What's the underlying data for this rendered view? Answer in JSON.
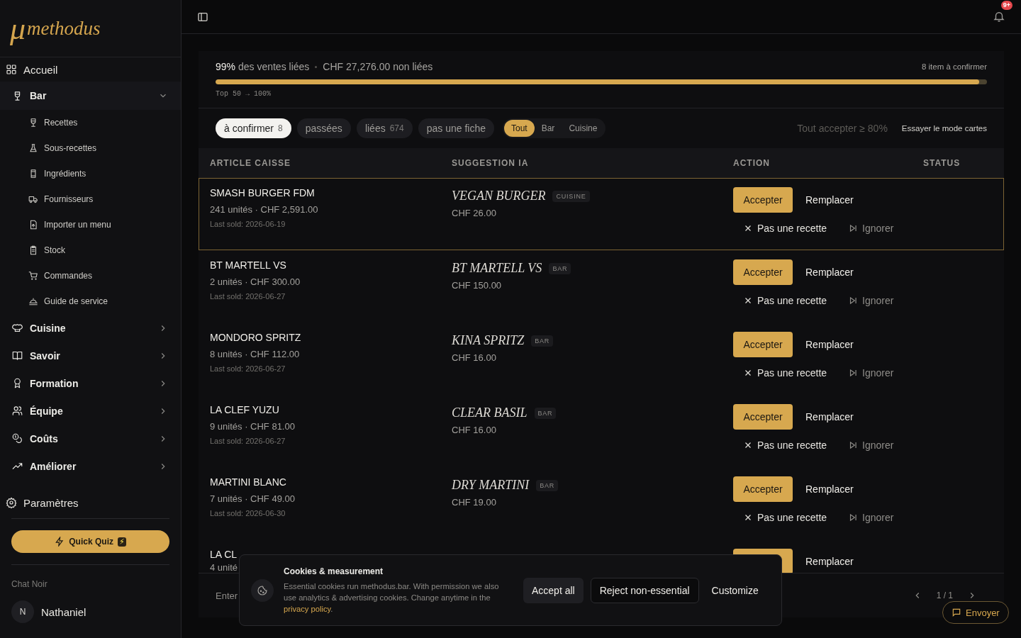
{
  "topbar": {
    "notification_badge": "9+"
  },
  "sidebar": {
    "logo": {
      "mark": "μ",
      "text": "methodus"
    },
    "nav": [
      {
        "label": "Accueil",
        "kind": "link"
      },
      {
        "label": "Bar",
        "kind": "group",
        "expanded": true,
        "children": [
          {
            "label": "Recettes"
          },
          {
            "label": "Sous-recettes"
          },
          {
            "label": "Ingrédients"
          },
          {
            "label": "Fournisseurs"
          },
          {
            "label": "Importer un menu"
          },
          {
            "label": "Stock"
          },
          {
            "label": "Commandes"
          },
          {
            "label": "Guide de service"
          }
        ]
      },
      {
        "label": "Cuisine",
        "kind": "group",
        "expanded": false
      },
      {
        "label": "Savoir",
        "kind": "group",
        "expanded": false
      },
      {
        "label": "Formation",
        "kind": "group",
        "expanded": false
      },
      {
        "label": "Équipe",
        "kind": "group",
        "expanded": false
      },
      {
        "label": "Coûts",
        "kind": "group",
        "expanded": false
      },
      {
        "label": "Améliorer",
        "kind": "group",
        "expanded": false
      },
      {
        "label": "Paramètres",
        "kind": "link"
      }
    ],
    "quiz_button": {
      "label": "Quick Quiz",
      "emoji": "⚡"
    },
    "workspace": "Chat Noir",
    "user": {
      "initial": "N",
      "name": "Nathaniel"
    }
  },
  "summary": {
    "linked_share": "99%",
    "linked_label": "des ventes liées",
    "unlinked": "CHF 27,276.00 non liées",
    "pending": "8 item à confirmer",
    "level": 0.99,
    "caption": "Top 50 → 100%"
  },
  "filters": [
    {
      "label": "à confirmer",
      "count": "8",
      "selected": true
    },
    {
      "label": "passées",
      "selected": false
    },
    {
      "label": "liées",
      "count": "674",
      "selected": false
    },
    {
      "label": "pas une fiche",
      "selected": false
    }
  ],
  "scope": [
    {
      "label": "Tout",
      "selected": true
    },
    {
      "label": "Bar",
      "selected": false
    },
    {
      "label": "Cuisine",
      "selected": false
    }
  ],
  "bulk_actions": [
    {
      "label": "Tout accepter ≥ 80%",
      "disabled": true
    },
    {
      "label": "Essayer le mode cartes",
      "disabled": false
    }
  ],
  "table": {
    "columns": [
      "ARTICLE CAISSE",
      "SUGGESTION IA",
      "ACTION",
      "STATUS"
    ],
    "rows": [
      {
        "name": "SMASH BURGER FDM",
        "units": "241 unités · CHF 2,591.00",
        "last_sold": "Last sold: 2026-06-19",
        "suggestion": "VEGAN BURGER",
        "category": "CUISINE",
        "price": "CHF 26.00",
        "accept": "Accepter",
        "replace": "Remplacer",
        "not_recipe": "Pas une recette",
        "ignore": "Ignorer",
        "selected": true
      },
      {
        "name": "BT MARTELL VS",
        "units": "2 unités · CHF 300.00",
        "last_sold": "Last sold: 2026-06-27",
        "suggestion": "BT MARTELL VS",
        "category": "BAR",
        "price": "CHF 150.00",
        "accept": "Accepter",
        "replace": "Remplacer",
        "not_recipe": "Pas une recette",
        "ignore": "Ignorer",
        "selected": false
      },
      {
        "name": "MONDORO SPRITZ",
        "units": "8 unités · CHF 112.00",
        "last_sold": "Last sold: 2026-06-27",
        "suggestion": "KINA SPRITZ",
        "category": "BAR",
        "price": "CHF 16.00",
        "accept": "Accepter",
        "replace": "Remplacer",
        "not_recipe": "Pas une recette",
        "ignore": "Ignorer",
        "selected": false
      },
      {
        "name": "LA CLEF YUZU",
        "units": "9 unités · CHF 81.00",
        "last_sold": "Last sold: 2026-06-27",
        "suggestion": "CLEAR BASIL",
        "category": "BAR",
        "price": "CHF 16.00",
        "accept": "Accepter",
        "replace": "Remplacer",
        "not_recipe": "Pas une recette",
        "ignore": "Ignorer",
        "selected": false
      },
      {
        "name": "MARTINI BLANC",
        "units": "7 unités · CHF 49.00",
        "last_sold": "Last sold: 2026-06-30",
        "suggestion": "DRY MARTINI",
        "category": "BAR",
        "price": "CHF 19.00",
        "accept": "Accepter",
        "replace": "Remplacer",
        "not_recipe": "Pas une recette",
        "ignore": "Ignorer",
        "selected": false
      },
      {
        "name": "LA CL",
        "units": "4 unité",
        "replace": "Remplacer"
      }
    ]
  },
  "footer": {
    "hint": "Enter",
    "page": "1 / 1"
  },
  "send_button": "Envoyer",
  "cookie_banner": {
    "title": "Cookies & measurement",
    "text": "Essential cookies run methodus.bar. With permission we also use analytics & advertising cookies. Change anytime in the ",
    "link": "privacy policy",
    "text_end": ".",
    "buttons": [
      {
        "label": "Accept all",
        "kind": "secondary"
      },
      {
        "label": "Reject non-essential",
        "kind": "outline"
      },
      {
        "label": "Customize",
        "kind": "plain"
      }
    ]
  }
}
